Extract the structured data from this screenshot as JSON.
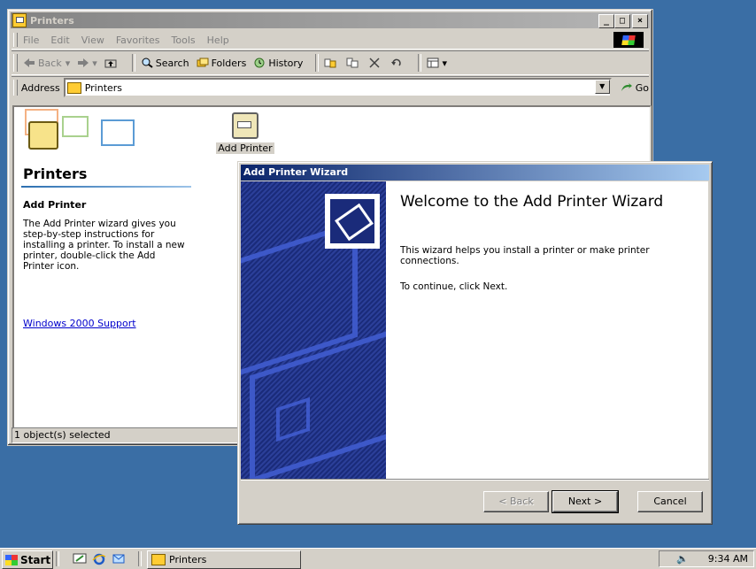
{
  "explorer": {
    "title": "Printers",
    "menu": [
      "File",
      "Edit",
      "View",
      "Favorites",
      "Tools",
      "Help"
    ],
    "toolbar": {
      "back": "Back",
      "search": "Search",
      "folders": "Folders",
      "history": "History"
    },
    "address": {
      "label": "Address",
      "value": "Printers",
      "go": "Go"
    },
    "left_pane": {
      "title": "Printers",
      "heading": "Add Printer",
      "description": "The Add Printer wizard gives you step-by-step instructions for installing a printer. To install a new printer, double-click the Add Printer icon.",
      "link": "Windows 2000 Support"
    },
    "items": [
      {
        "label": "Add Printer",
        "icon": "add-printer-icon"
      }
    ],
    "status": "1 object(s) selected"
  },
  "wizard": {
    "title": "Add Printer Wizard",
    "heading": "Welcome to the Add Printer Wizard",
    "description": "This wizard helps you install a printer or make printer connections.",
    "continue_text": "To continue, click Next.",
    "buttons": {
      "back": "< Back",
      "next": "Next >",
      "cancel": "Cancel"
    }
  },
  "taskbar": {
    "start": "Start",
    "task": "Printers",
    "clock": "9:34 AM"
  },
  "colors": {
    "desktop": "#3a6ea5",
    "active_title": "#0a246a",
    "inactive_title": "#848484",
    "link": "#0000cc"
  }
}
